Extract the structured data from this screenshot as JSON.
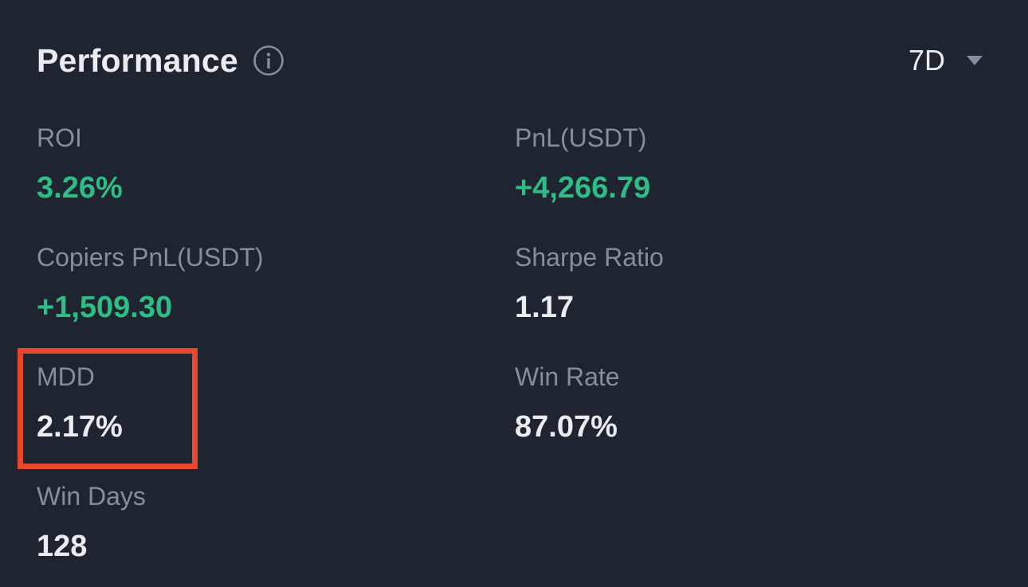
{
  "header": {
    "title": "Performance",
    "info_icon": "info-circle-icon",
    "period": "7D",
    "period_icon": "caret-down-icon"
  },
  "metrics": {
    "roi": {
      "label": "ROI",
      "value": "3.26%"
    },
    "pnl": {
      "label": "PnL(USDT)",
      "value": "+4,266.79"
    },
    "copiers_pnl": {
      "label": "Copiers PnL(USDT)",
      "value": "+1,509.30"
    },
    "sharpe": {
      "label": "Sharpe Ratio",
      "value": "1.17"
    },
    "mdd": {
      "label": "MDD",
      "value": "2.17%"
    },
    "win_rate": {
      "label": "Win Rate",
      "value": "87.07%"
    },
    "win_days": {
      "label": "Win Days",
      "value": "128"
    }
  },
  "colors": {
    "background": "#1f2530",
    "positive": "#2ebd85",
    "label": "#858e9c",
    "value": "#eaecef",
    "highlight": "#e8472f"
  }
}
